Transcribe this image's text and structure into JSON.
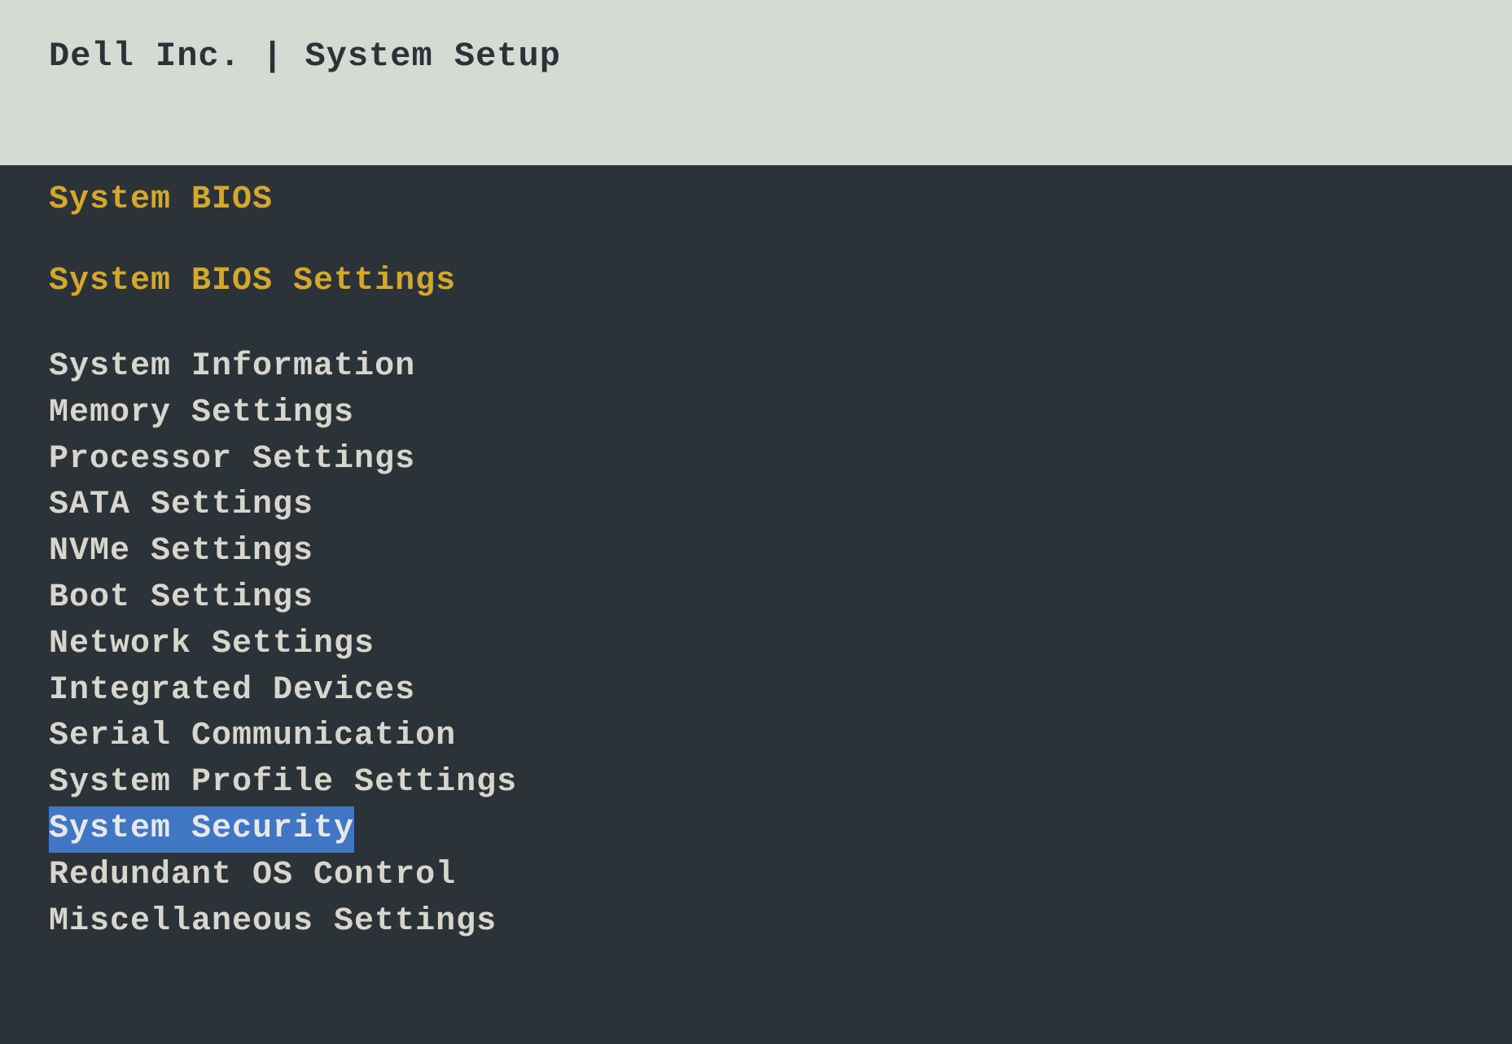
{
  "header": {
    "title": "Dell Inc. | System Setup"
  },
  "bios": {
    "section_title": "System BIOS",
    "subsection_title": "System BIOS Settings",
    "menu_items": [
      {
        "label": "System Information",
        "selected": false
      },
      {
        "label": "Memory Settings",
        "selected": false
      },
      {
        "label": "Processor Settings",
        "selected": false
      },
      {
        "label": "SATA Settings",
        "selected": false
      },
      {
        "label": "NVMe Settings",
        "selected": false
      },
      {
        "label": "Boot Settings",
        "selected": false
      },
      {
        "label": "Network Settings",
        "selected": false
      },
      {
        "label": "Integrated Devices",
        "selected": false
      },
      {
        "label": "Serial Communication",
        "selected": false
      },
      {
        "label": "System Profile Settings",
        "selected": false
      },
      {
        "label": "System Security",
        "selected": true
      },
      {
        "label": "Redundant OS Control",
        "selected": false
      },
      {
        "label": "Miscellaneous Settings",
        "selected": false
      }
    ]
  },
  "colors": {
    "header_bg": "#d5dbd3",
    "header_text": "#2c3338",
    "content_bg": "#2c3338",
    "accent_yellow": "#d4a82d",
    "menu_text": "#d8d5cc",
    "selection_bg": "#4176c4"
  }
}
